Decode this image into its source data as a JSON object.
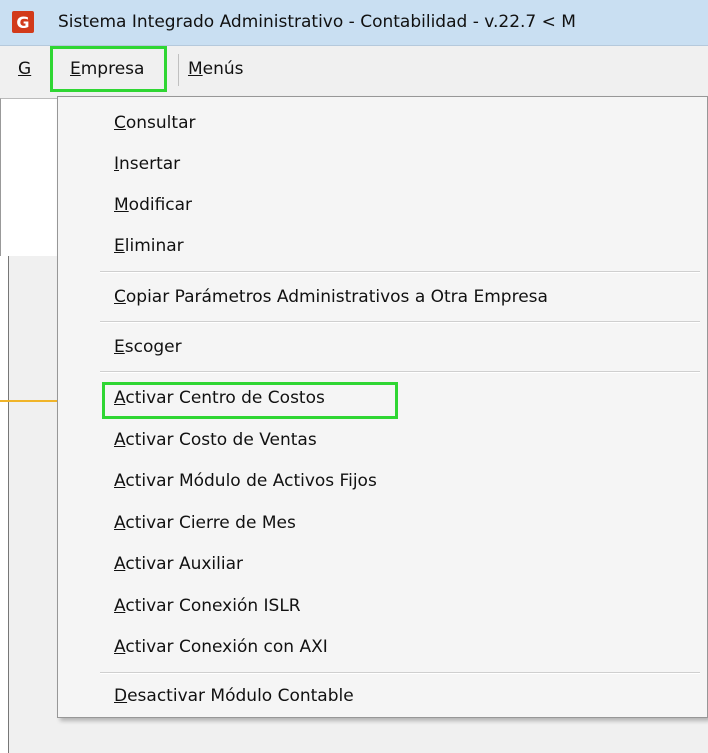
{
  "window": {
    "title": "Sistema Integrado Administrativo - Contabilidad - v.22.7 < M",
    "icon": "app-logo-icon",
    "icon_glyph": "G"
  },
  "menubar": {
    "items": [
      {
        "label": "G",
        "accel": "G",
        "rest": ""
      },
      {
        "label": "Empresa",
        "accel": "E",
        "rest": "mpresa"
      },
      {
        "label": "Menús",
        "accel": "M",
        "rest": "enús"
      }
    ]
  },
  "dropdown": {
    "items": [
      {
        "accel": "C",
        "rest": "onsultar"
      },
      {
        "accel": "I",
        "rest": "nsertar"
      },
      {
        "accel": "M",
        "rest": "odificar"
      },
      {
        "accel": "E",
        "rest": "liminar"
      },
      {
        "accel": "C",
        "rest": "opiar Parámetros Administrativos a Otra Empresa"
      },
      {
        "accel": "E",
        "rest": "scoger"
      },
      {
        "accel": "A",
        "rest": "ctivar Centro de Costos"
      },
      {
        "accel": "A",
        "rest": "ctivar Costo de Ventas"
      },
      {
        "accel": "A",
        "rest": "ctivar Módulo de Activos Fijos"
      },
      {
        "accel": "A",
        "rest": "ctivar Cierre de Mes"
      },
      {
        "accel": "A",
        "rest": "ctivar Auxiliar"
      },
      {
        "accel": "A",
        "rest": "ctivar Conexión ISLR"
      },
      {
        "accel": "A",
        "rest": "ctivar Conexión con AXI"
      },
      {
        "accel": "D",
        "rest": "esactivar Módulo Contable"
      }
    ]
  },
  "colors": {
    "highlight": "#2fd633",
    "callout": "#f0b429"
  }
}
